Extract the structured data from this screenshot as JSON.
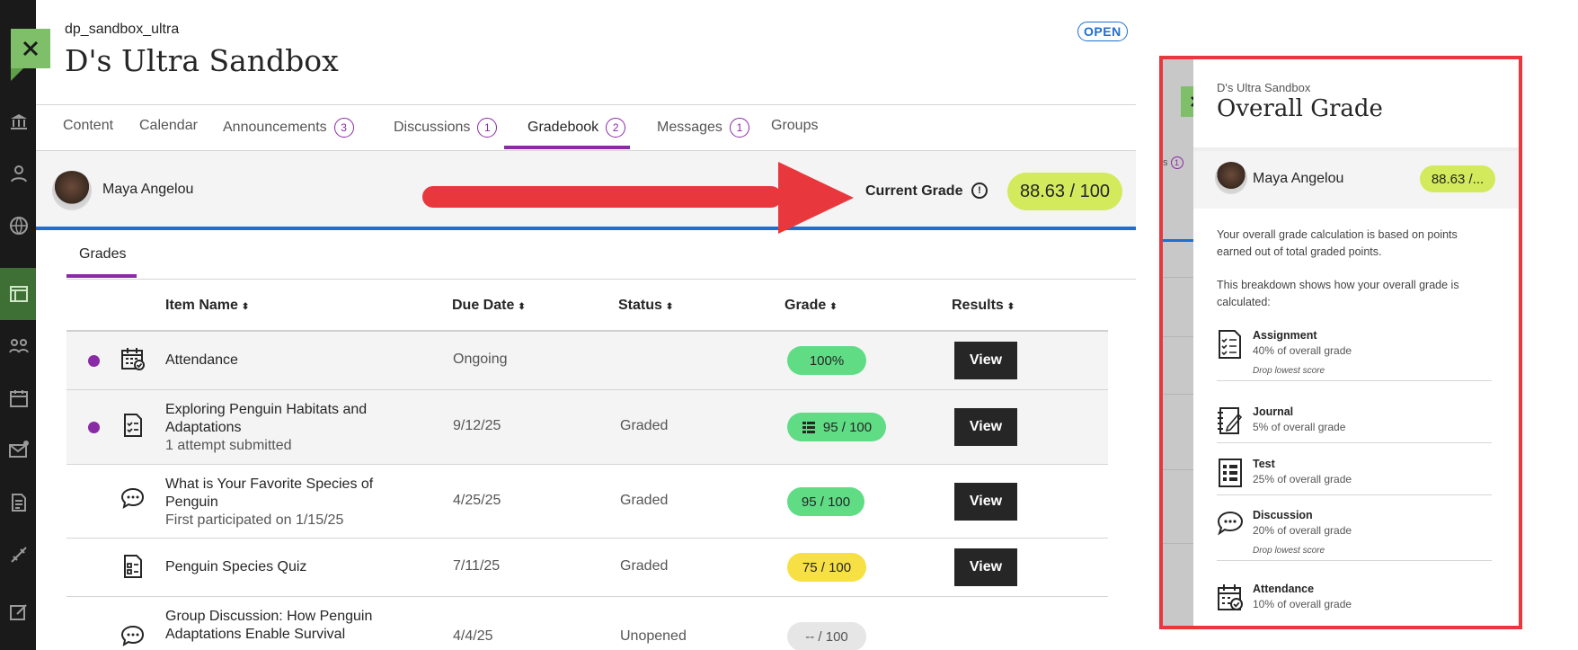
{
  "course": {
    "id": "dp_sandbox_ultra",
    "title": "D's Ultra Sandbox",
    "status": "OPEN"
  },
  "tabs": [
    {
      "label": "Content",
      "count": ""
    },
    {
      "label": "Calendar",
      "count": ""
    },
    {
      "label": "Announcements",
      "count": "3"
    },
    {
      "label": "Discussions",
      "count": "1"
    },
    {
      "label": "Gradebook",
      "count": "2"
    },
    {
      "label": "Messages",
      "count": "1"
    },
    {
      "label": "Groups",
      "count": ""
    }
  ],
  "student": {
    "name": "Maya Angelou",
    "current_grade_label": "Current Grade",
    "current_grade": "88.63 / 100"
  },
  "grades_tab": "Grades",
  "columns": {
    "item": "Item Name",
    "due": "Due Date",
    "status": "Status",
    "grade": "Grade",
    "results": "Results"
  },
  "rows": [
    {
      "name": "Attendance",
      "sub": "",
      "due": "Ongoing",
      "status": "",
      "grade": "100%",
      "grade_color": "#5fdc84",
      "result": "View"
    },
    {
      "name": "Exploring Penguin Habitats and Adaptations",
      "sub": "1 attempt submitted",
      "due": "9/12/25",
      "status": "Graded",
      "grade": "95 / 100",
      "grade_color": "#5fdc84",
      "result": "View"
    },
    {
      "name": "What is Your Favorite Species of Penguin",
      "sub": "First participated on 1/15/25",
      "due": "4/25/25",
      "status": "Graded",
      "grade": "95 / 100",
      "grade_color": "#5fdc84",
      "result": "View"
    },
    {
      "name": "Penguin Species Quiz",
      "sub": "",
      "due": "7/11/25",
      "status": "Graded",
      "grade": "75 / 100",
      "grade_color": "#f7e043",
      "result": "View"
    },
    {
      "name": "Group Discussion: How Penguin Adaptations Enable Survival",
      "sub": "",
      "due": "4/4/25",
      "status": "Unopened",
      "grade": "-- / 100",
      "grade_color": "#e6e6e6",
      "result": ""
    }
  ],
  "panel": {
    "course": "D's Ultra Sandbox",
    "title": "Overall Grade",
    "student_name": "Maya Angelou",
    "grade": "88.63 /...",
    "desc1": "Your overall grade calculation is based on points earned out of total graded points.",
    "desc2": "This breakdown shows how your overall grade is calculated:",
    "items": [
      {
        "title": "Assignment",
        "pct": "40% of overall grade",
        "note": "Drop lowest score"
      },
      {
        "title": "Journal",
        "pct": "5% of overall grade",
        "note": ""
      },
      {
        "title": "Test",
        "pct": "25% of overall grade",
        "note": ""
      },
      {
        "title": "Discussion",
        "pct": "20% of overall grade",
        "note": "Drop lowest score"
      },
      {
        "title": "Attendance",
        "pct": "10% of overall grade",
        "note": ""
      }
    ],
    "peek_badge": "1"
  },
  "colors": {
    "accent_purple": "#8a2aa6",
    "accent_blue": "#1d6fd1",
    "grade_green": "#5fdc84",
    "grade_yellow": "#f7e043",
    "current_grade": "#d3ea5c",
    "highlight_red": "#e8383e"
  }
}
